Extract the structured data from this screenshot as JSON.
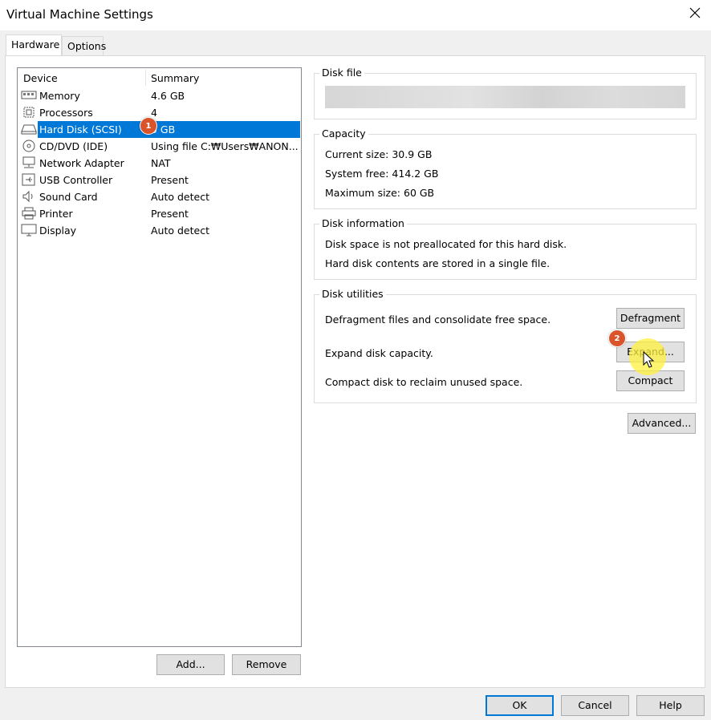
{
  "window": {
    "title": "Virtual Machine Settings",
    "close_glyph": "✕"
  },
  "tabs": [
    {
      "label": "Hardware"
    },
    {
      "label": "Options"
    }
  ],
  "device_list": {
    "headers": {
      "device": "Device",
      "summary": "Summary"
    },
    "rows": [
      {
        "name": "Memory",
        "summary": "4.6 GB",
        "icon": "memory-icon"
      },
      {
        "name": "Processors",
        "summary": "4",
        "icon": "processor-icon"
      },
      {
        "name": "Hard Disk (SCSI)",
        "summary": "0 GB",
        "icon": "hard-disk-icon",
        "selected": true
      },
      {
        "name": "CD/DVD (IDE)",
        "summary": "Using file C:₩Users₩ANON...",
        "icon": "cd-dvd-icon"
      },
      {
        "name": "Network Adapter",
        "summary": "NAT",
        "icon": "network-adapter-icon"
      },
      {
        "name": "USB Controller",
        "summary": "Present",
        "icon": "usb-icon"
      },
      {
        "name": "Sound Card",
        "summary": "Auto detect",
        "icon": "speaker-icon"
      },
      {
        "name": "Printer",
        "summary": "Present",
        "icon": "printer-icon"
      },
      {
        "name": "Display",
        "summary": "Auto detect",
        "icon": "monitor-icon"
      }
    ]
  },
  "badges": {
    "step1": "1",
    "step2": "2"
  },
  "list_buttons": {
    "add": "Add...",
    "remove": "Remove"
  },
  "disk_file": {
    "title": "Disk file"
  },
  "capacity": {
    "title": "Capacity",
    "current_size": "Current size:  30.9 GB",
    "system_free": "System free:  414.2 GB",
    "maximum_size": "Maximum size:  60 GB"
  },
  "disk_information": {
    "title": "Disk information",
    "line1": "Disk space is not preallocated for this hard disk.",
    "line2": "Hard disk contents are stored in a single file."
  },
  "disk_utilities": {
    "title": "Disk utilities",
    "defrag_text": "Defragment files and consolidate free space.",
    "defrag_button": "Defragment",
    "expand_text": "Expand disk capacity.",
    "expand_button": "Expand...",
    "compact_text": "Compact disk to reclaim unused space.",
    "compact_button": "Compact"
  },
  "advanced_button": "Advanced...",
  "footer": {
    "ok": "OK",
    "cancel": "Cancel",
    "help": "Help"
  },
  "colors": {
    "selection": "#0078d7",
    "badge": "#d9542b",
    "highlight": "#fff03c"
  }
}
